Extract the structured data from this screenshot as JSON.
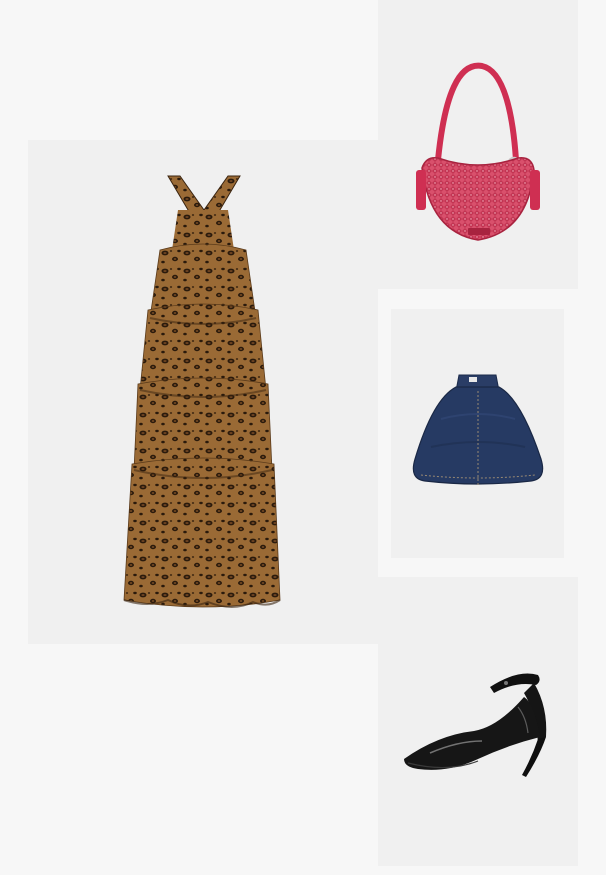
{
  "outfit": {
    "items": [
      {
        "name": "leopard-print-tiered-halter-dress",
        "icon": "dress-icon"
      },
      {
        "name": "pink-chain-shoulder-bag",
        "icon": "handbag-icon"
      },
      {
        "name": "denim-cape",
        "icon": "cape-icon"
      },
      {
        "name": "black-patent-ankle-strap-pump",
        "icon": "pump-shoe-icon"
      }
    ]
  },
  "colors": {
    "page_background": "#f7f7f7",
    "tile_background": "#f0f0f0",
    "leopard_base": "#8a5a2b",
    "bag_pink": "#d23a5a",
    "denim": "#24375f",
    "patent_black": "#141414"
  }
}
